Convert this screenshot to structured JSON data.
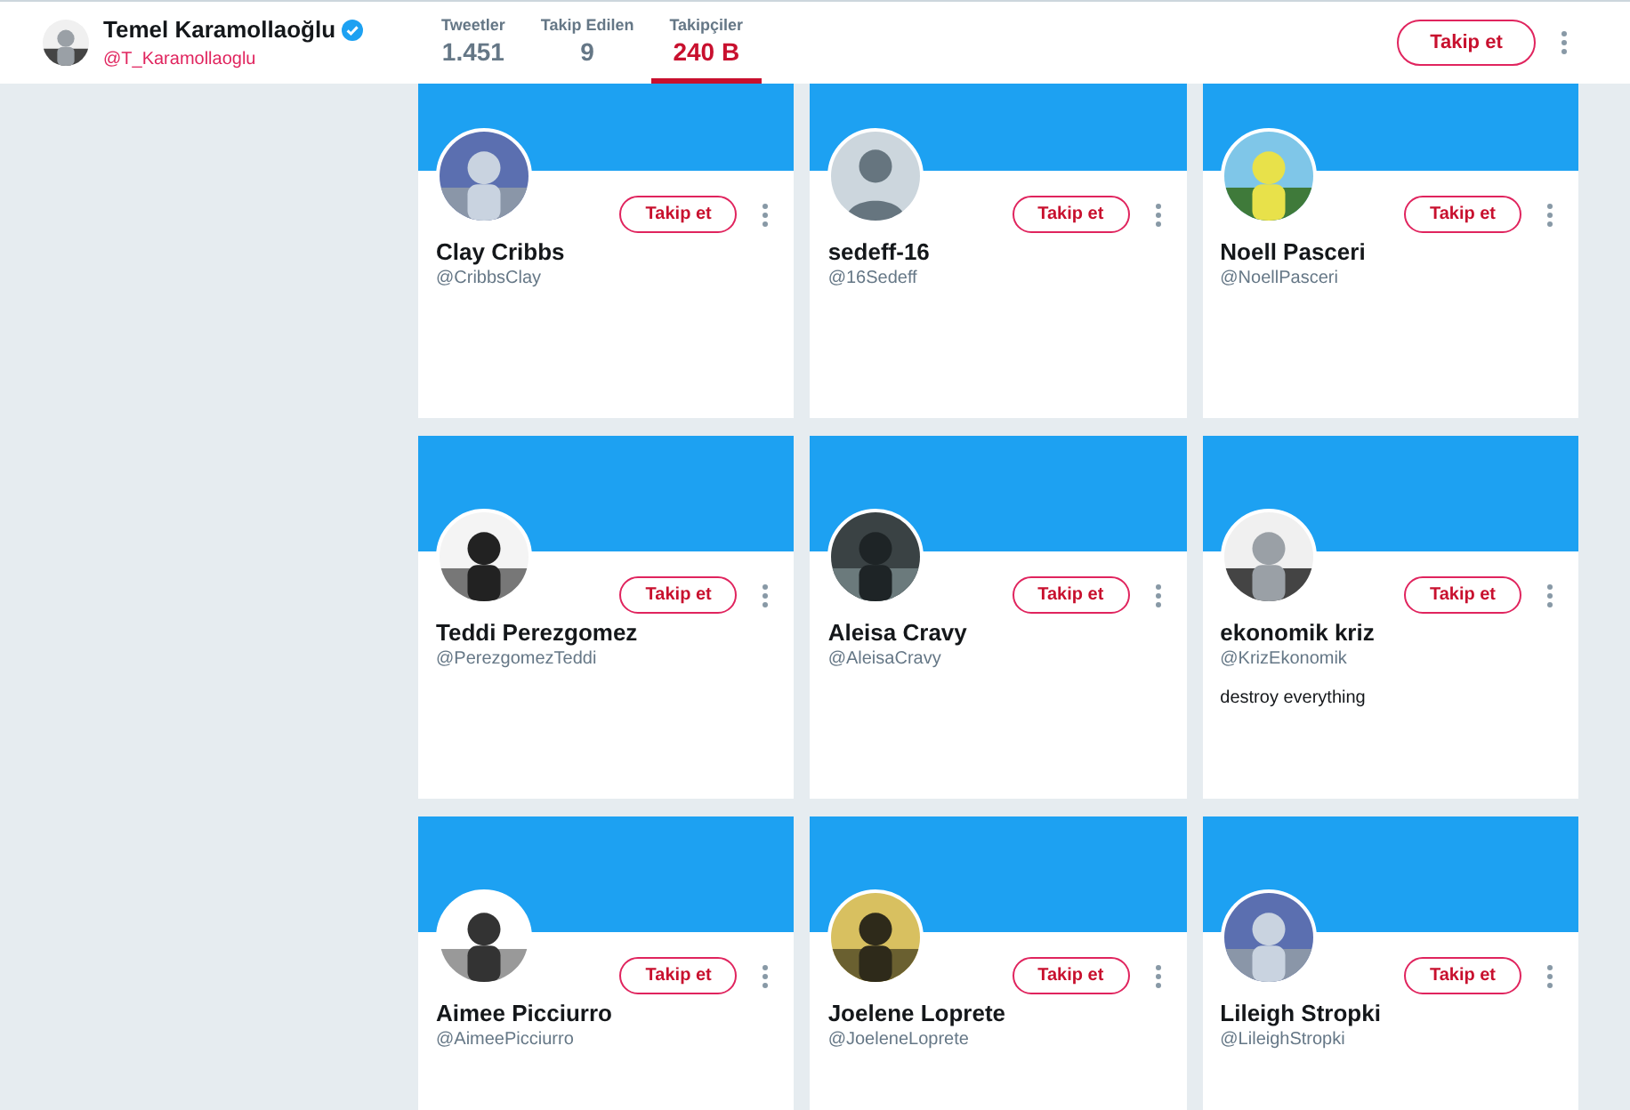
{
  "profile": {
    "name": "Temel Karamollaoğlu",
    "verified": true,
    "handle": "@T_Karamollaoglu",
    "follow_button": "Takip et"
  },
  "stats": [
    {
      "label": "Tweetler",
      "value": "1.451",
      "selected": false
    },
    {
      "label": "Takip Edilen",
      "value": "9",
      "selected": false
    },
    {
      "label": "Takipçiler",
      "value": "240 B",
      "selected": true
    }
  ],
  "followers": [
    {
      "name": "Clay Cribbs",
      "handle": "@CribbsClay",
      "button": "Takip et"
    },
    {
      "name": "sedeff-16",
      "handle": "@16Sedeff",
      "avatar": {
        "kind": "default"
      },
      "button": "Takip et"
    },
    {
      "name": "Noell Pasceri",
      "handle": "@NoellPasceri",
      "button": "Takip et"
    },
    {
      "name": "Teddi Perezgomez",
      "handle": "@PerezgomezTeddi",
      "button": "Takip et"
    },
    {
      "name": "Aleisa Cravy",
      "handle": "@AleisaCravy",
      "button": "Takip et"
    },
    {
      "name": "ekonomik kriz",
      "handle": "@KrizEkonomik",
      "bio": "destroy everything",
      "button": "Takip et"
    },
    {
      "name": "Aimee Picciurro",
      "handle": "@AimeePicciurro",
      "button": "Takip et"
    },
    {
      "name": "Joelene Loprete",
      "handle": "@JoeleneLoprete",
      "button": "Takip et"
    },
    {
      "name": "Lileigh Stropki",
      "handle": "@LileighStropki",
      "button": "Takip et"
    }
  ]
}
